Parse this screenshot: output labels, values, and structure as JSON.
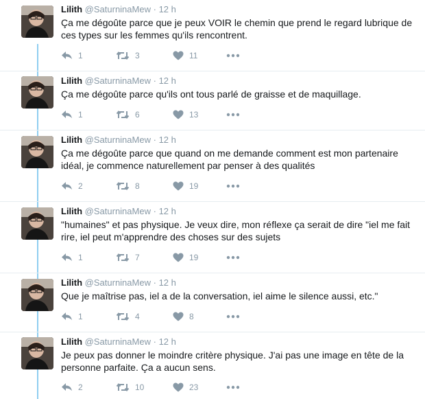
{
  "tweets": [
    {
      "name": "Lilith",
      "handle": "@SaturninaMew",
      "time": "12 h",
      "text": "Ça me dégoûte parce que je peux VOIR le chemin que prend le regard lubrique de ces types sur les femmes qu'ils rencontrent.",
      "replies": "1",
      "retweets": "3",
      "likes": "11"
    },
    {
      "name": "Lilith",
      "handle": "@SaturninaMew",
      "time": "12 h",
      "text": "Ça me dégoûte parce qu'ils ont tous parlé de graisse et de maquillage.",
      "replies": "1",
      "retweets": "6",
      "likes": "13"
    },
    {
      "name": "Lilith",
      "handle": "@SaturninaMew",
      "time": "12 h",
      "text": "Ça me dégoûte parce que quand on me demande comment est mon partenaire idéal, je commence naturellement par penser à des qualités",
      "replies": "2",
      "retweets": "8",
      "likes": "19"
    },
    {
      "name": "Lilith",
      "handle": "@SaturninaMew",
      "time": "12 h",
      "text": "\"humaines\" et pas physique. Je veux dire, mon réflexe ça serait de dire \"iel me fait rire, iel peut m'apprendre des choses sur des sujets",
      "replies": "1",
      "retweets": "7",
      "likes": "19"
    },
    {
      "name": "Lilith",
      "handle": "@SaturninaMew",
      "time": "12 h",
      "text": "Que je maîtrise pas, iel a de la conversation, iel aime le silence aussi, etc.\"",
      "replies": "1",
      "retweets": "4",
      "likes": "8"
    },
    {
      "name": "Lilith",
      "handle": "@SaturninaMew",
      "time": "12 h",
      "text": "Je peux pas donner le moindre critère physique. J'ai pas une image en tête de la personne parfaite. Ça a aucun sens.",
      "replies": "2",
      "retweets": "10",
      "likes": "23"
    }
  ],
  "separator": "·",
  "icons": {
    "reply": "reply-icon",
    "retweet": "retweet-icon",
    "like": "heart-icon",
    "more": "more-dots-icon"
  },
  "colors": {
    "thread_line": "#8ecdf0",
    "meta": "#8899a6",
    "text": "#14171a"
  }
}
